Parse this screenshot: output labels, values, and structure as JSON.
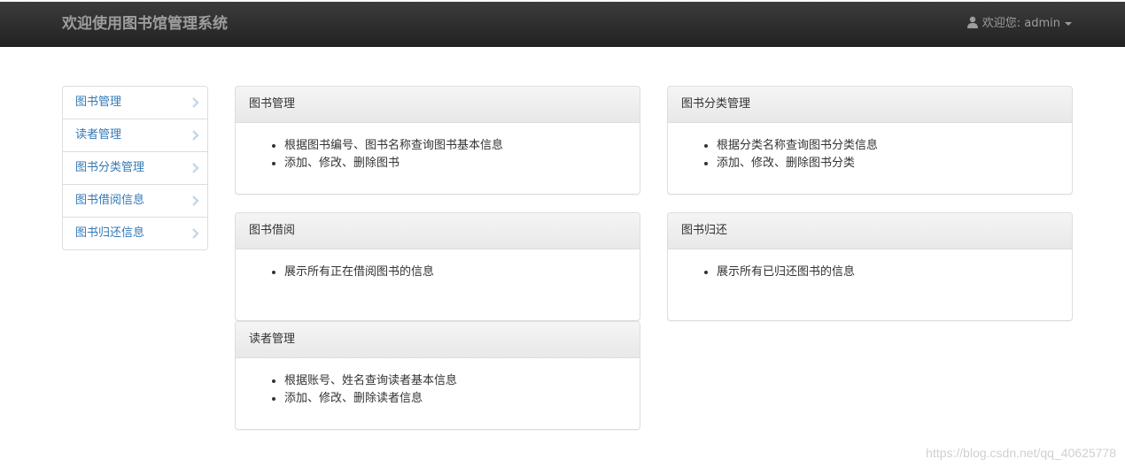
{
  "navbar": {
    "brand": "欢迎使用图书馆管理系统",
    "user_label": "欢迎您: admin"
  },
  "sidebar": {
    "items": [
      {
        "label": "图书管理"
      },
      {
        "label": "读者管理"
      },
      {
        "label": "图书分类管理"
      },
      {
        "label": "图书借阅信息"
      },
      {
        "label": "图书归还信息"
      }
    ]
  },
  "panels": {
    "book_mgmt": {
      "title": "图书管理",
      "items": [
        "根据图书编号、图书名称查询图书基本信息",
        "添加、修改、删除图书"
      ]
    },
    "category_mgmt": {
      "title": "图书分类管理",
      "items": [
        "根据分类名称查询图书分类信息",
        "添加、修改、删除图书分类"
      ]
    },
    "borrow": {
      "title": "图书借阅",
      "items": [
        "展示所有正在借阅图书的信息"
      ]
    },
    "return": {
      "title": "图书归还",
      "items": [
        "展示所有已归还图书的信息"
      ]
    },
    "reader_mgmt": {
      "title": "读者管理",
      "items": [
        "根据账号、姓名查询读者基本信息",
        "添加、修改、删除读者信息"
      ]
    }
  },
  "watermark": "https://blog.csdn.net/qq_40625778",
  "colors": {
    "navbar": "#222222",
    "link": "#337ab7",
    "chevron": "#c5d9ea"
  }
}
